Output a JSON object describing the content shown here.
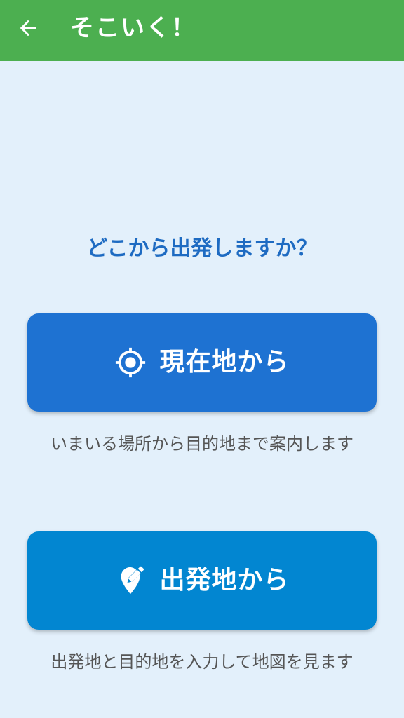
{
  "app_bar": {
    "title": "そこいく！",
    "back_icon": "arrow-left-icon",
    "background_color": "#4caf50"
  },
  "main": {
    "question": "どこから出発しますか？",
    "options": [
      {
        "label": "現在地から",
        "icon": "my-location-icon",
        "description": "いまいる場所から目的地まで案内します",
        "color": "#1e72d2"
      },
      {
        "label": "出発地から",
        "icon": "edit-location-icon",
        "description": "出発地と目的地を入力して地図を見ます",
        "color": "#0286d1"
      }
    ]
  },
  "colors": {
    "background": "#e3f0fb",
    "question_text": "#1e6bc2",
    "description_text": "#555555"
  }
}
